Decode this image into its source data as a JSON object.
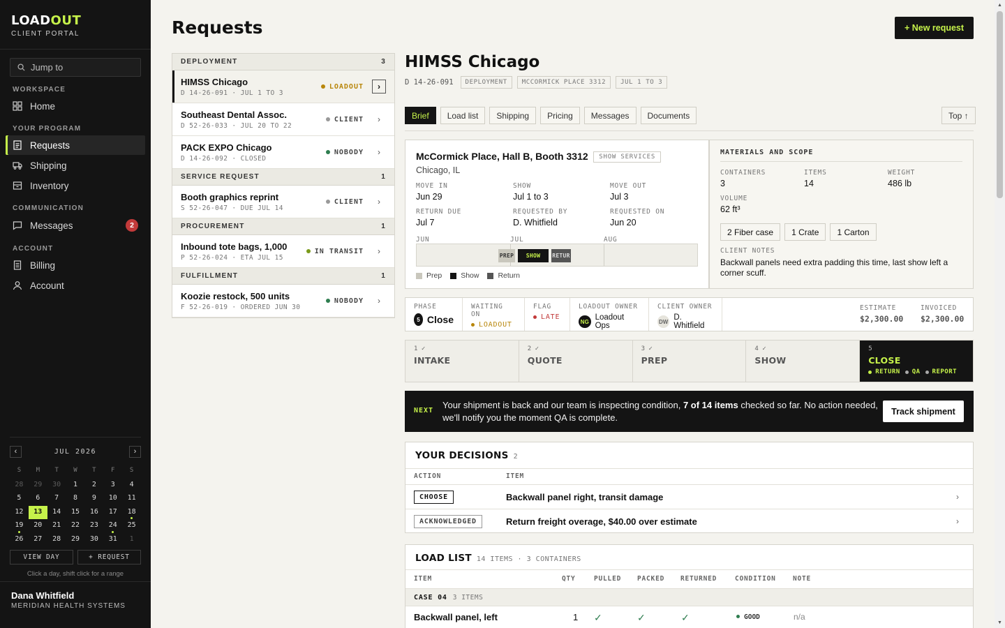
{
  "brand": {
    "name_a": "LOAD",
    "name_b": "OUT",
    "subtitle": "CLIENT PORTAL"
  },
  "sidebar": {
    "jump_placeholder": "Jump to",
    "sections": {
      "workspace": "WORKSPACE",
      "program": "YOUR PROGRAM",
      "communication": "COMMUNICATION",
      "account": "ACCOUNT"
    },
    "items": {
      "home": "Home",
      "requests": "Requests",
      "shipping": "Shipping",
      "inventory": "Inventory",
      "messages": "Messages",
      "messages_badge": "2",
      "billing": "Billing",
      "account": "Account"
    },
    "calendar": {
      "title": "JUL 2026",
      "prev": "‹",
      "next": "›",
      "weekdays": [
        "S",
        "M",
        "T",
        "W",
        "T",
        "F",
        "S"
      ],
      "weeks": [
        [
          "28",
          "29",
          "30",
          "1",
          "2",
          "3",
          "4"
        ],
        [
          "5",
          "6",
          "7",
          "8",
          "9",
          "10",
          "11"
        ],
        [
          "12",
          "13",
          "14",
          "15",
          "16",
          "17",
          "18"
        ],
        [
          "19",
          "20",
          "21",
          "22",
          "23",
          "24",
          "25"
        ],
        [
          "26",
          "27",
          "28",
          "29",
          "30",
          "31",
          "1"
        ]
      ],
      "today": "13",
      "view_day": "VIEW DAY",
      "new_request": "+ REQUEST",
      "hint": "Click a day, shift click for a range"
    },
    "user": {
      "name": "Dana Whitfield",
      "org": "MERIDIAN HEALTH SYSTEMS"
    }
  },
  "page": {
    "title": "Requests",
    "new_request": "+ New request"
  },
  "request_list": {
    "groups": [
      {
        "name": "DEPLOYMENT",
        "count": "3",
        "rows": [
          {
            "title": "HIMSS Chicago",
            "sub": "D 14-26-091 · JUL 1 TO 3",
            "status": "LOADOUT",
            "color": "#b8860b",
            "selected": true
          },
          {
            "title": "Southeast Dental Assoc.",
            "sub": "D 52-26-033 · JUL 20 TO 22",
            "status": "CLIENT",
            "color": "#999999"
          },
          {
            "title": "PACK EXPO Chicago",
            "sub": "D 14-26-092 · CLOSED",
            "status": "NOBODY",
            "color": "#2e7d4f"
          }
        ]
      },
      {
        "name": "SERVICE REQUEST",
        "count": "1",
        "rows": [
          {
            "title": "Booth graphics reprint",
            "sub": "S 52-26-047 · DUE JUL 14",
            "status": "CLIENT",
            "color": "#999999"
          }
        ]
      },
      {
        "name": "PROCUREMENT",
        "count": "1",
        "rows": [
          {
            "title": "Inbound tote bags, 1,000",
            "sub": "P 52-26-024 · ETA JUL 15",
            "status": "IN TRANSIT",
            "color": "#7a9a1a"
          }
        ]
      },
      {
        "name": "FULFILLMENT",
        "count": "1",
        "rows": [
          {
            "title": "Koozie restock, 500 units",
            "sub": "F 52-26-019 · ORDERED JUN 30",
            "status": "NOBODY",
            "color": "#2e7d4f"
          }
        ]
      }
    ]
  },
  "detail": {
    "title": "HIMSS Chicago",
    "id": "D 14-26-091",
    "chips": [
      "DEPLOYMENT",
      "MCCORMICK PLACE 3312",
      "JUL 1 TO 3"
    ],
    "tabs": [
      "Brief",
      "Load list",
      "Shipping",
      "Pricing",
      "Messages",
      "Documents"
    ],
    "top_button": "Top ↑",
    "brief": {
      "venue": "McCormick Place, Hall B, Booth 3312",
      "show_services": "SHOW SERVICES",
      "city": "Chicago, IL",
      "fields": [
        {
          "label": "MOVE IN",
          "value": "Jun 29"
        },
        {
          "label": "SHOW",
          "value": "Jul 1 to 3"
        },
        {
          "label": "MOVE OUT",
          "value": "Jul 3"
        },
        {
          "label": "RETURN DUE",
          "value": "Jul 7"
        },
        {
          "label": "REQUESTED BY",
          "value": "D. Whitfield"
        },
        {
          "label": "REQUESTED ON",
          "value": "Jun 20"
        }
      ],
      "timeline_months": [
        "JUN",
        "JUL",
        "AUG"
      ],
      "timeline_segments": [
        "PREP",
        "SHOW",
        "RETUR"
      ],
      "legend": [
        "Prep",
        "Show",
        "Return"
      ]
    },
    "materials": {
      "title": "MATERIALS AND SCOPE",
      "stats": [
        {
          "label": "CONTAINERS",
          "value": "3"
        },
        {
          "label": "ITEMS",
          "value": "14"
        },
        {
          "label": "WEIGHT",
          "value": "486 lb"
        },
        {
          "label": "VOLUME",
          "value": "62 ft³"
        }
      ],
      "containers": [
        {
          "count": "2",
          "type": "Fiber case"
        },
        {
          "count": "1",
          "type": "Crate"
        },
        {
          "count": "1",
          "type": "Carton"
        }
      ],
      "notes_label": "CLIENT NOTES",
      "notes": "Backwall panels need extra padding this time, last show left a corner scuff."
    },
    "status": {
      "phase_label": "PHASE",
      "phase_num": "5",
      "phase": "Close",
      "waiting_label": "WAITING ON",
      "waiting": "LOADOUT",
      "flag_label": "FLAG",
      "flag": "LATE",
      "loadout_owner_label": "LOADOUT OWNER",
      "loadout_owner_initials": "NG",
      "loadout_owner": "Loadout Ops",
      "client_owner_label": "CLIENT OWNER",
      "client_owner_initials": "DW",
      "client_owner": "D. Whitfield",
      "estimate_label": "ESTIMATE",
      "estimate": "$2,300.00",
      "invoiced_label": "INVOICED",
      "invoiced": "$2,300.00"
    },
    "steps": [
      {
        "num": "1 ✓",
        "name": "INTAKE"
      },
      {
        "num": "2 ✓",
        "name": "QUOTE"
      },
      {
        "num": "3 ✓",
        "name": "PREP"
      },
      {
        "num": "4 ✓",
        "name": "SHOW"
      },
      {
        "num": "5",
        "name": "CLOSE",
        "substeps": [
          "RETURN",
          "QA",
          "REPORT"
        ]
      }
    ],
    "next": {
      "label": "NEXT",
      "text_a": "Your shipment is back and our team is inspecting condition, ",
      "text_b": "7 of 14 items",
      "text_c": " checked so far. No action needed, we'll notify you the moment QA is complete.",
      "button": "Track shipment"
    },
    "decisions": {
      "title": "YOUR DECISIONS",
      "count": "2",
      "col_action": "ACTION",
      "col_item": "ITEM",
      "rows": [
        {
          "action": "CHOOSE",
          "item": "Backwall panel right, transit damage"
        },
        {
          "action": "ACKNOWLEDGED",
          "item": "Return freight overage, $40.00 over estimate"
        }
      ]
    },
    "load_list": {
      "title": "LOAD LIST",
      "meta": "14 ITEMS · 3 CONTAINERS",
      "columns": [
        "ITEM",
        "QTY",
        "PULLED",
        "PACKED",
        "RETURNED",
        "CONDITION",
        "NOTE"
      ],
      "case_name": "CASE 04",
      "case_count": "3 ITEMS",
      "rows": [
        {
          "item": "Backwall panel, left",
          "qty": "1",
          "pulled": "✓",
          "packed": "✓",
          "returned": "✓",
          "condition": "GOOD",
          "note": "n/a"
        }
      ]
    }
  }
}
